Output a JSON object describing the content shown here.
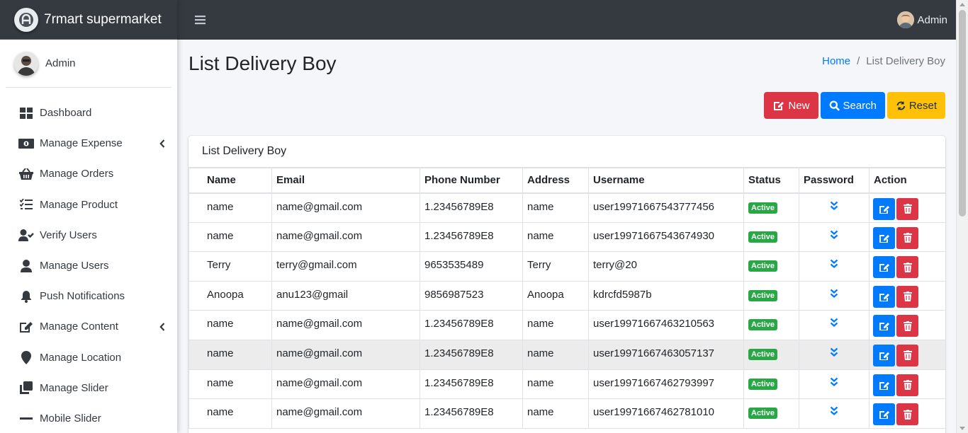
{
  "brand": {
    "name": "7rmart supermarket"
  },
  "sidebar": {
    "user_name": "Admin",
    "items": [
      {
        "label": "Dashboard",
        "icon": "dashboard-icon",
        "has_submenu": false
      },
      {
        "label": "Manage Expense",
        "icon": "money-icon",
        "has_submenu": true
      },
      {
        "label": "Manage Orders",
        "icon": "basket-icon",
        "has_submenu": false
      },
      {
        "label": "Manage Product",
        "icon": "tasks-icon",
        "has_submenu": false
      },
      {
        "label": "Verify Users",
        "icon": "user-check-icon",
        "has_submenu": false
      },
      {
        "label": "Manage Users",
        "icon": "user-icon",
        "has_submenu": false
      },
      {
        "label": "Push Notifications",
        "icon": "bell-icon",
        "has_submenu": false
      },
      {
        "label": "Manage Content",
        "icon": "edit-icon",
        "has_submenu": true
      },
      {
        "label": "Manage Location",
        "icon": "map-marker-icon",
        "has_submenu": false
      },
      {
        "label": "Manage Slider",
        "icon": "clone-icon",
        "has_submenu": false
      },
      {
        "label": "Mobile Slider",
        "icon": "minus-icon",
        "has_submenu": false
      }
    ]
  },
  "topbar": {
    "user_name": "Admin"
  },
  "page": {
    "title": "List Delivery Boy",
    "breadcrumb": {
      "home": "Home",
      "separator": "/",
      "current": "List Delivery Boy"
    }
  },
  "actions": {
    "new_label": "New",
    "search_label": "Search",
    "reset_label": "Reset"
  },
  "card": {
    "title": "List Delivery Boy"
  },
  "table": {
    "columns": [
      "Name",
      "Email",
      "Phone Number",
      "Address",
      "Username",
      "Status",
      "Password",
      "Action"
    ],
    "rows": [
      {
        "name": "name",
        "email": "name@gmail.com",
        "phone": "1.23456789E8",
        "address": "name",
        "username": "user19971667543777456",
        "status": "Active"
      },
      {
        "name": "name",
        "email": "name@gmail.com",
        "phone": "1.23456789E8",
        "address": "name",
        "username": "user19971667543674930",
        "status": "Active"
      },
      {
        "name": "Terry",
        "email": "terry@gmail.com",
        "phone": "9653535489",
        "address": "Terry",
        "username": "terry@20",
        "status": "Active"
      },
      {
        "name": "Anoopa",
        "email": "anu123@gmail",
        "phone": "9856987523",
        "address": "Anoopa",
        "username": "kdrcfd5987b",
        "status": "Active"
      },
      {
        "name": "name",
        "email": "name@gmail.com",
        "phone": "1.23456789E8",
        "address": "name",
        "username": "user19971667463210563",
        "status": "Active"
      },
      {
        "name": "name",
        "email": "name@gmail.com",
        "phone": "1.23456789E8",
        "address": "name",
        "username": "user19971667463057137",
        "status": "Active"
      },
      {
        "name": "name",
        "email": "name@gmail.com",
        "phone": "1.23456789E8",
        "address": "name",
        "username": "user19971667462793997",
        "status": "Active"
      },
      {
        "name": "name",
        "email": "name@gmail.com",
        "phone": "1.23456789E8",
        "address": "name",
        "username": "user19971667462781010",
        "status": "Active"
      }
    ]
  },
  "colors": {
    "topbar": "#343a40",
    "primary": "#007bff",
    "danger": "#dc3545",
    "warning": "#ffc107",
    "success": "#28a745"
  }
}
